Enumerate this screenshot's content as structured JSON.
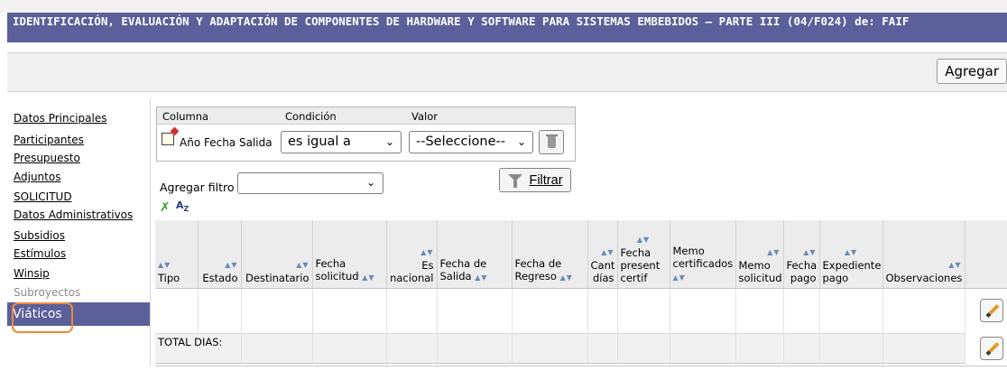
{
  "title": "IDENTIFICACIÓN, EVALUACIÓN Y ADAPTACIÓN DE COMPONENTES DE HARDWARE Y SOFTWARE PARA SISTEMAS EMBEBIDOS – PARTE III (04/F024) de: FAIF",
  "toolbar": {
    "agregar_label": "Agregar"
  },
  "sidebar": {
    "items": [
      {
        "label": "Datos Principales"
      },
      {
        "label": "Participantes"
      },
      {
        "label": "Presupuesto"
      },
      {
        "label": "Adjuntos"
      },
      {
        "label": "SOLICITUD"
      },
      {
        "label": "Datos Administrativos"
      },
      {
        "label": "Subsidios"
      },
      {
        "label": "Estímulos"
      },
      {
        "label": "Winsip"
      },
      {
        "label": "Subroyectos"
      },
      {
        "label": "Viáticos"
      }
    ]
  },
  "filter": {
    "col_header": "Columna",
    "cond_header": "Condición",
    "val_header": "Valor",
    "column_name": "Año Fecha Salida",
    "condition_value": "es igual a",
    "value_value": "--Seleccione--",
    "add_filter_label": "Agregar filtro",
    "add_filter_value": "",
    "filtrar_label": "Filtrar"
  },
  "grid": {
    "headers": [
      "Tipo",
      "Estado",
      "Destinatario",
      "Fecha solicitud",
      "Es nacional",
      "Fecha de Salida",
      "Fecha de Regreso",
      "Cant días",
      "Fecha present certif",
      "Memo certificados",
      "Memo solicitud",
      "Fecha pago",
      "Expediente pago",
      "Observaciones"
    ],
    "total_label": "TOTAL DIAS:"
  },
  "colors": {
    "accent": "#5b5f9a",
    "highlight": "#ee8a3a"
  }
}
